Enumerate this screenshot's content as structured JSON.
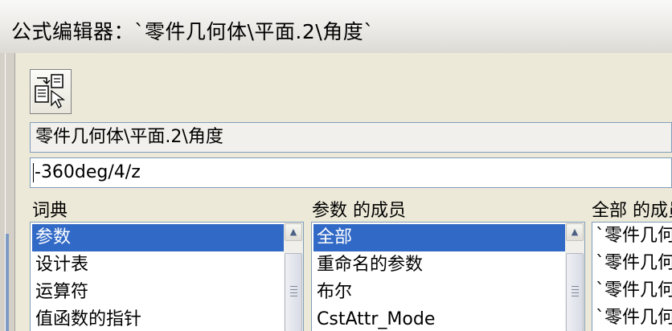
{
  "window": {
    "title": "公式编辑器：`零件几何体\\平面.2\\角度`"
  },
  "toolbar": {
    "button_icon": "formula-import-icon"
  },
  "path_field": {
    "value": "零件几何体\\平面.2\\角度"
  },
  "formula_field": {
    "value": "-360deg/4/z"
  },
  "dictionary": {
    "label": "词典",
    "items": [
      "参数",
      "设计表",
      "运算符",
      "值函数的指针"
    ],
    "selected": "参数"
  },
  "members": {
    "label": "参数 的成员",
    "items": [
      "全部",
      "重命名的参数",
      "布尔",
      "CstAttr_Mode"
    ],
    "selected": "全部"
  },
  "all_members": {
    "label": "全部 的成员",
    "items": [
      "`零件几何",
      "`零件几何",
      "`零件几何",
      "`零件几何"
    ]
  },
  "scrollbar": {
    "up_icon": "arrow-up-icon",
    "grip_icon": "grip-icon"
  }
}
